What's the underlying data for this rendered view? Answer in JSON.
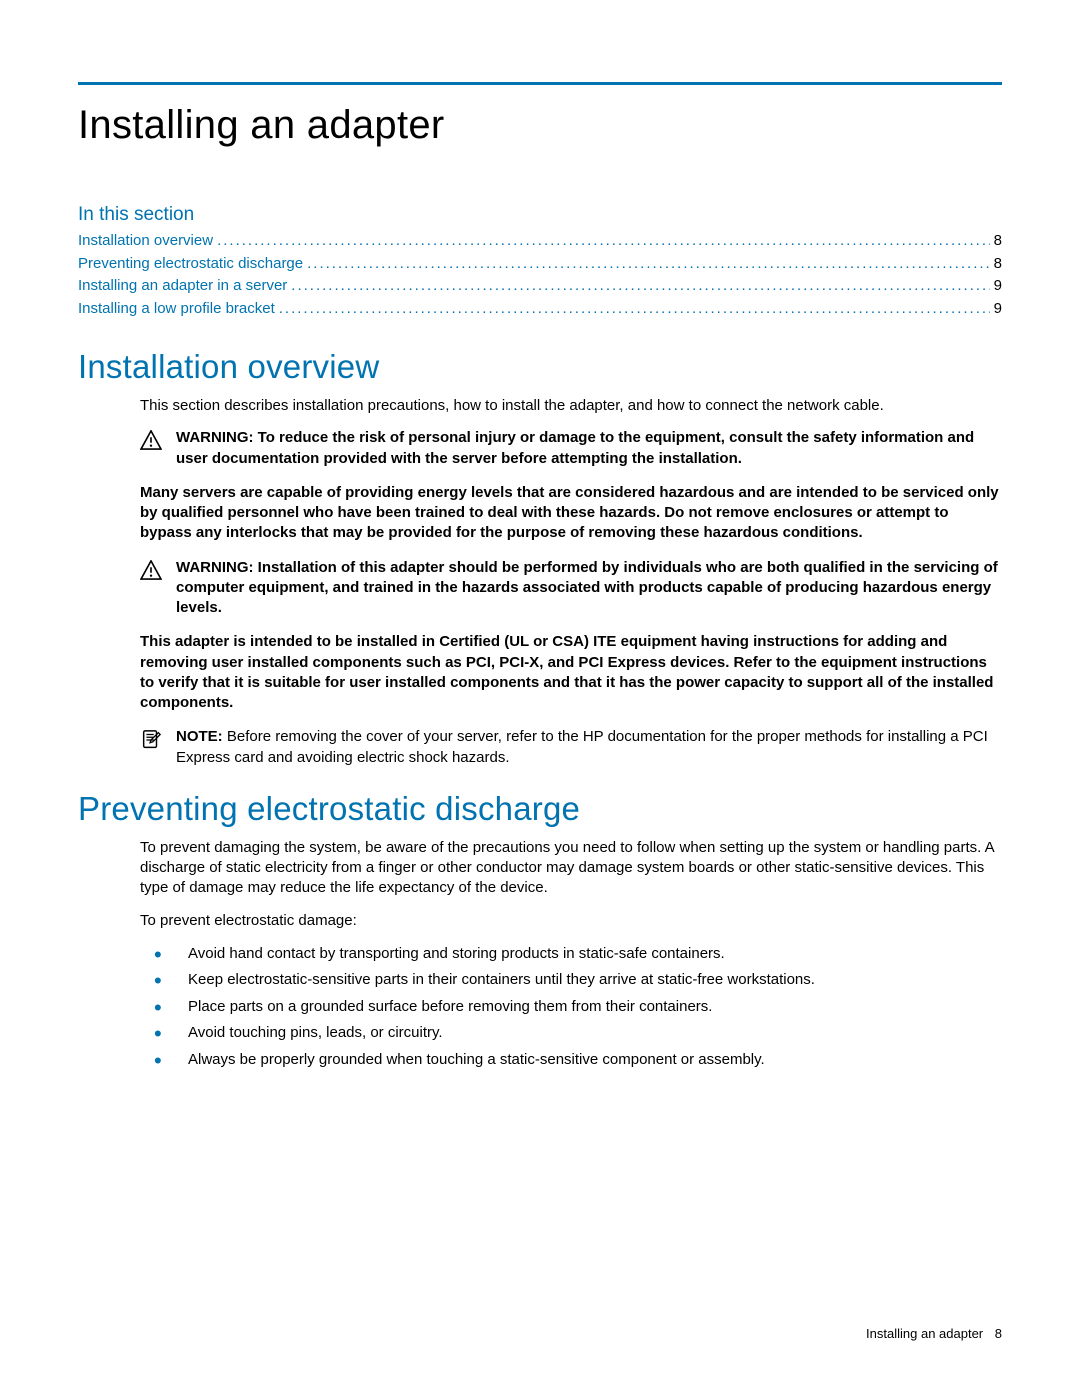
{
  "chapter_title": "Installing an adapter",
  "in_this_section_label": "In this section",
  "toc": [
    {
      "label": "Installation overview",
      "page": "8"
    },
    {
      "label": "Preventing electrostatic discharge",
      "page": "8"
    },
    {
      "label": "Installing an adapter in a server",
      "page": "9"
    },
    {
      "label": "Installing a low profile bracket",
      "page": "9"
    }
  ],
  "h2_overview": "Installation overview",
  "overview_intro": "This section describes installation precautions, how to install the adapter, and how to connect the network cable.",
  "warn1_lead": "WARNING:  ",
  "warn1_text": "To reduce the risk of personal injury or damage to the equipment, consult the safety information and user documentation provided with the server before attempting the installation.",
  "warn1_sub": "Many servers are capable of providing energy levels that are considered hazardous and are intended to be serviced only by qualified personnel who have been trained to deal with these hazards. Do not remove enclosures or attempt to bypass any interlocks that may be provided for the purpose of removing these hazardous conditions.",
  "warn2_lead": "WARNING:  ",
  "warn2_text": "Installation of this adapter should be performed by individuals who are both qualified in the servicing of computer equipment, and trained in the hazards associated with products capable of producing hazardous energy levels.",
  "warn2_sub": "This adapter is intended to be installed in Certified (UL or CSA) ITE equipment having instructions for adding and removing user installed components such as PCI, PCI-X, and PCI Express devices. Refer to the equipment instructions to verify that it is suitable for user installed components and that it has the power capacity to support all of the installed components.",
  "note_lead": "NOTE: ",
  "note_text": "Before removing the cover of your server, refer to the HP documentation for the proper methods for installing a PCI Express card and avoiding electric shock hazards.",
  "h2_esd": "Preventing electrostatic discharge",
  "esd_intro": "To prevent damaging the system, be aware of the precautions you need to follow when setting up the system or handling parts. A discharge of static electricity from a finger or other conductor may damage system boards or other static-sensitive devices. This type of damage may reduce the life expectancy of the device.",
  "esd_lead": "To prevent electrostatic damage:",
  "esd_bullets": [
    "Avoid hand contact by transporting and storing products in static-safe containers.",
    "Keep electrostatic-sensitive parts in their containers until they arrive at static-free workstations.",
    "Place parts on a grounded surface before removing them from their containers.",
    "Avoid touching pins, leads, or circuitry.",
    "Always be properly grounded when touching a static-sensitive component or assembly."
  ],
  "footer_label": "Installing an adapter",
  "footer_page": "8",
  "dots": "........................................................................................................................................................................................................................................................................"
}
